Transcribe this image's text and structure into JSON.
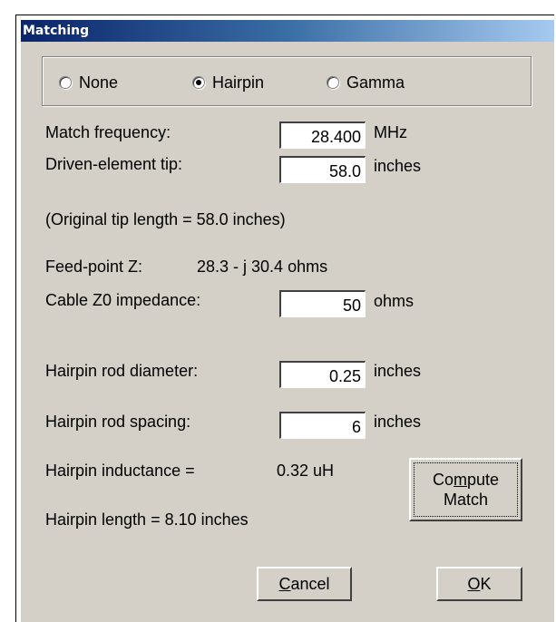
{
  "window": {
    "title": "Matching"
  },
  "match_type": {
    "options": [
      {
        "label": "None",
        "selected": false
      },
      {
        "label": "Hairpin",
        "selected": true
      },
      {
        "label": "Gamma",
        "selected": false
      }
    ]
  },
  "match_frequency": {
    "label": "Match frequency:",
    "value": "28.400",
    "unit": "MHz"
  },
  "driven_tip": {
    "label": "Driven-element tip:",
    "value": "58.0",
    "unit": "inches"
  },
  "original_tip": "(Original tip length = 58.0 inches)",
  "feed_point": {
    "label": "Feed-point Z:",
    "value": "28.3 - j 30.4 ohms"
  },
  "cable_z0": {
    "label": "Cable Z0 impedance:",
    "value": "50",
    "unit": "ohms"
  },
  "rod_diameter": {
    "label": "Hairpin rod diameter:",
    "value": "0.25",
    "unit": "inches"
  },
  "rod_spacing": {
    "label": "Hairpin rod spacing:",
    "value": "6",
    "unit": "inches"
  },
  "inductance": {
    "label": "Hairpin inductance =",
    "value": "0.32 uH"
  },
  "hairpin_length": "Hairpin length = 8.10 inches",
  "buttons": {
    "compute_line1_pre": "Co",
    "compute_line1_acc": "m",
    "compute_line1_post": "pute",
    "compute_line2": "Match",
    "cancel_acc": "C",
    "cancel_rest": "ancel",
    "ok_acc": "O",
    "ok_rest": "K"
  }
}
